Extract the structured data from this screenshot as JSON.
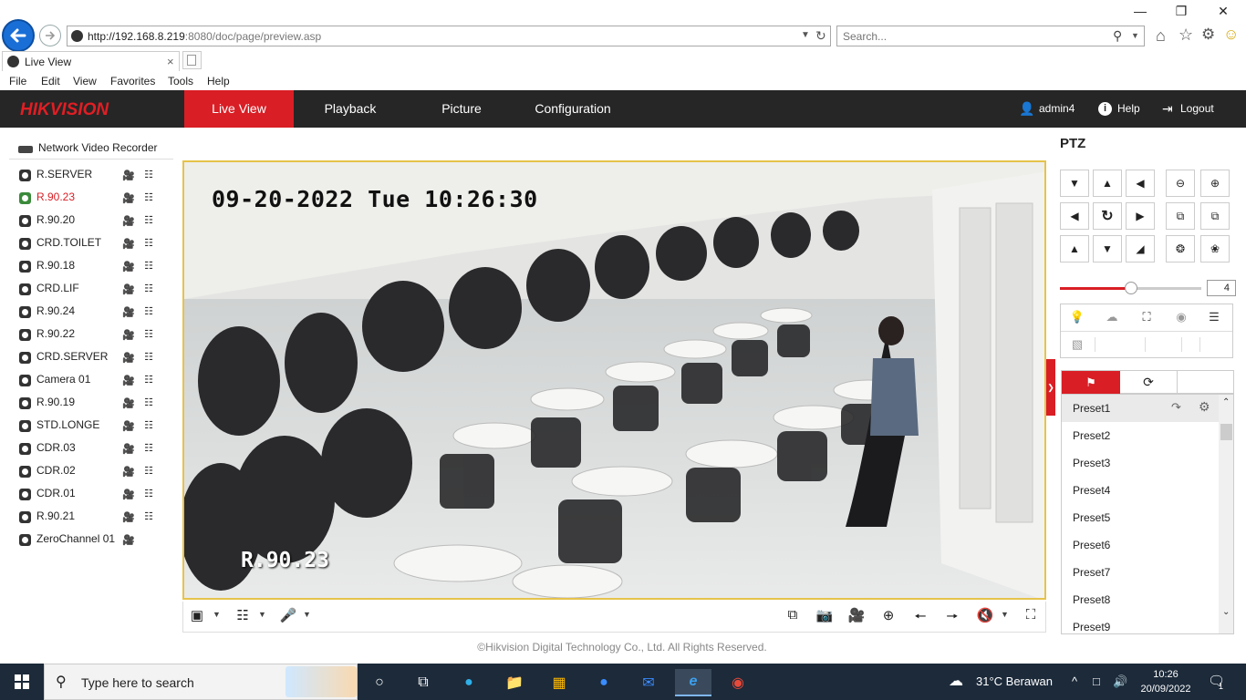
{
  "browser": {
    "url_main": "http://192.168.8.219",
    "url_rest": ":8080/doc/page/preview.asp",
    "search_placeholder": "Search...",
    "tab_title": "Live View",
    "menu": [
      "File",
      "Edit",
      "View",
      "Favorites",
      "Tools",
      "Help"
    ]
  },
  "header": {
    "logo": "HIKVISION",
    "nav": [
      "Live View",
      "Playback",
      "Picture",
      "Configuration"
    ],
    "active_nav": "Live View",
    "user": "admin4",
    "help": "Help",
    "logout": "Logout"
  },
  "tree": {
    "root": "Network Video Recorder",
    "cameras": [
      "R.SERVER",
      "R.90.23",
      "R.90.20",
      "CRD.TOILET",
      "R.90.18",
      "CRD.LIF",
      "R.90.24",
      "R.90.22",
      "CRD.SERVER",
      "Camera 01",
      "R.90.19",
      "STD.LONGE",
      "CDR.03",
      "CDR.02",
      "CDR.01",
      "R.90.21",
      "ZeroChannel 01"
    ],
    "active_camera": "R.90.23"
  },
  "video": {
    "osd_time": "09-20-2022 Tue 10:26:30",
    "osd_camera": "R.90.23"
  },
  "footer": {
    "copyright": "©Hikvision Digital Technology Co., Ltd. All Rights Reserved."
  },
  "ptz": {
    "title": "PTZ",
    "speed": "4",
    "speed_fraction": 0.5,
    "presets": [
      "Preset1",
      "Preset2",
      "Preset3",
      "Preset4",
      "Preset5",
      "Preset6",
      "Preset7",
      "Preset8",
      "Preset9"
    ]
  },
  "taskbar": {
    "search_placeholder": "Type here to search",
    "weather": "31°C  Berawan",
    "time": "10:26",
    "date": "20/09/2022",
    "notifications": "1"
  },
  "colors": {
    "accent_red": "#d91e25",
    "header_bg": "#262626",
    "video_border": "#e6c34b"
  }
}
